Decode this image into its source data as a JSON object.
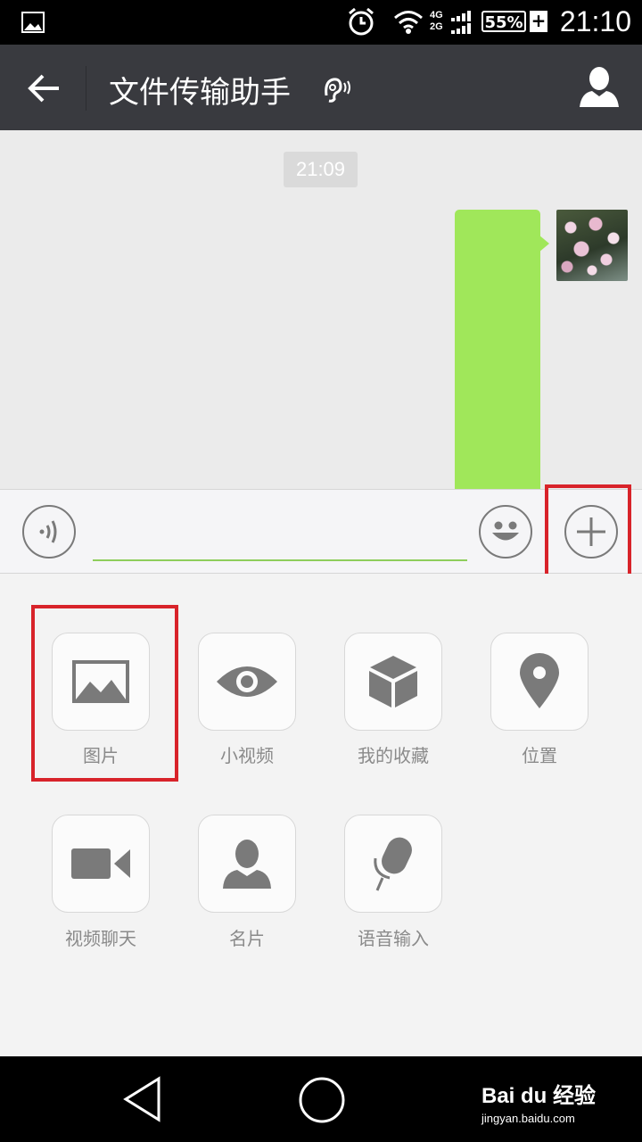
{
  "status_bar": {
    "network_top": "4G",
    "network_bottom": "2G",
    "battery": "55%",
    "time": "21:10"
  },
  "header": {
    "title": "文件传输助手"
  },
  "chat": {
    "timestamp": "21:09"
  },
  "input": {
    "value": ""
  },
  "panel": {
    "items": [
      {
        "label": "图片",
        "icon": "image-icon"
      },
      {
        "label": "小视频",
        "icon": "eye-icon"
      },
      {
        "label": "我的收藏",
        "icon": "cube-icon"
      },
      {
        "label": "位置",
        "icon": "location-pin-icon"
      },
      {
        "label": "视频聊天",
        "icon": "video-camera-icon"
      },
      {
        "label": "名片",
        "icon": "contact-card-icon"
      },
      {
        "label": "语音输入",
        "icon": "microphone-icon"
      }
    ]
  },
  "watermark": {
    "brand": "Bai du 经验",
    "url": "jingyan.baidu.com"
  },
  "colors": {
    "title_bar": "#393a3f",
    "bubble": "#a0e75a",
    "highlight": "#d8232a",
    "icon_gray": "#7a7a7a"
  }
}
